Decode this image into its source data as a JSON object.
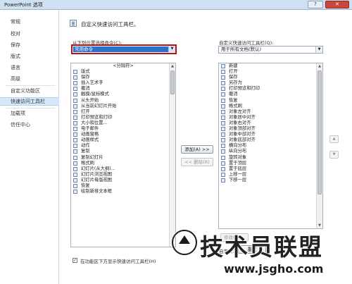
{
  "window": {
    "title": "PowerPoint 选项",
    "help_label": "?",
    "close_label": "✕"
  },
  "sidebar": {
    "items": [
      {
        "label": "常规"
      },
      {
        "label": "校对"
      },
      {
        "label": "保存"
      },
      {
        "label": "版式"
      },
      {
        "label": "语言"
      },
      {
        "label": "高级"
      },
      {
        "label": "自定义功能区"
      },
      {
        "label": "快速访问工具栏"
      },
      {
        "label": "加载项"
      },
      {
        "label": "信任中心"
      }
    ]
  },
  "main": {
    "heading": "自定义快速访问工具栏。",
    "choose_from_label": "从下列位置选择命令(C):",
    "choose_from_value": "常用命令",
    "customize_label": "自定义快速访问工具栏(Q):",
    "customize_value": "用于所有文档(默认)",
    "add_button": "添加(A) >>",
    "remove_button": "<< 删除(R)",
    "modify_button": "修改(M)...",
    "customizations_label": "自定义:",
    "reset_button": "重置",
    "checkbox_label": "在功能区下方显示快速访问工具栏(H)",
    "left_list": [
      {
        "label": "<分隔符>",
        "icon": "",
        "sub": "",
        "center": true
      },
      {
        "label": "版式",
        "icon": "layout-icon",
        "sub": "▸"
      },
      {
        "label": "保存",
        "icon": "save-icon",
        "sub": ""
      },
      {
        "label": "插入艺术字",
        "icon": "wordart-icon",
        "sub": "▸"
      },
      {
        "label": "撤消",
        "icon": "undo-icon",
        "sub": "▸"
      },
      {
        "label": "触摸/鼠标模式",
        "icon": "touch-icon",
        "sub": "▸"
      },
      {
        "label": "从头开始",
        "icon": "slideshow-icon",
        "sub": ""
      },
      {
        "label": "从当前幻灯片开始",
        "icon": "slideshow-current-icon",
        "sub": ""
      },
      {
        "label": "打开",
        "icon": "open-icon",
        "sub": ""
      },
      {
        "label": "打印预览和打印",
        "icon": "print-preview-icon",
        "sub": ""
      },
      {
        "label": "大小和位置...",
        "icon": "size-icon",
        "sub": ""
      },
      {
        "label": "电子邮件",
        "icon": "email-icon",
        "sub": ""
      },
      {
        "label": "动画窗格",
        "icon": "animation-pane-icon",
        "sub": ""
      },
      {
        "label": "动画样式",
        "icon": "animation-style-icon",
        "sub": "▸"
      },
      {
        "label": "动作",
        "icon": "action-icon",
        "sub": ""
      },
      {
        "label": "复制",
        "icon": "copy-icon",
        "sub": ""
      },
      {
        "label": "复制幻灯片",
        "icon": "duplicate-slide-icon",
        "sub": ""
      },
      {
        "label": "格式刷",
        "icon": "format-painter-icon",
        "sub": ""
      },
      {
        "label": "幻灯片(从大纲)...",
        "icon": "slides-outline-icon",
        "sub": ""
      },
      {
        "label": "幻灯片浏览视图",
        "icon": "slide-sorter-icon",
        "sub": ""
      },
      {
        "label": "幻灯片母版视图",
        "icon": "slide-master-icon",
        "sub": ""
      },
      {
        "label": "恢复",
        "icon": "redo-icon",
        "sub": ""
      },
      {
        "label": "绘制新排文本框",
        "icon": "textbox-icon",
        "sub": ""
      }
    ],
    "right_list": [
      {
        "label": "新建",
        "icon": "new-icon",
        "sub": ""
      },
      {
        "label": "打开",
        "icon": "open-icon",
        "sub": ""
      },
      {
        "label": "保存",
        "icon": "save-icon",
        "sub": ""
      },
      {
        "label": "另存为",
        "icon": "save-as-icon",
        "sub": ""
      },
      {
        "label": "打印预览和打印",
        "icon": "print-preview-icon",
        "sub": ""
      },
      {
        "label": "撤消",
        "icon": "undo-icon",
        "sub": "▸"
      },
      {
        "label": "恢复",
        "icon": "redo-icon",
        "sub": ""
      },
      {
        "label": "格式刷",
        "icon": "format-painter-icon",
        "sub": ""
      },
      {
        "label": "对象左对齐",
        "icon": "align-left-icon",
        "sub": ""
      },
      {
        "label": "对象居中对齐",
        "icon": "align-center-icon",
        "sub": ""
      },
      {
        "label": "对象右对齐",
        "icon": "align-right-icon",
        "sub": ""
      },
      {
        "label": "对象顶部对齐",
        "icon": "align-top-icon",
        "sub": ""
      },
      {
        "label": "对象中部对齐",
        "icon": "align-middle-icon",
        "sub": ""
      },
      {
        "label": "对象底部对齐",
        "icon": "align-bottom-icon",
        "sub": ""
      },
      {
        "label": "横向分布",
        "icon": "distribute-h-icon",
        "sub": ""
      },
      {
        "label": "纵向分布",
        "icon": "distribute-v-icon",
        "sub": ""
      },
      {
        "label": "旋转对象",
        "icon": "rotate-icon",
        "sub": "▸"
      },
      {
        "label": "置于顶层",
        "icon": "bring-front-icon",
        "sub": ""
      },
      {
        "label": "置于底层",
        "icon": "send-back-icon",
        "sub": ""
      },
      {
        "label": "上移一层",
        "icon": "bring-forward-icon",
        "sub": ""
      },
      {
        "label": "下移一层",
        "icon": "send-backward-icon",
        "sub": ""
      }
    ]
  },
  "watermark": {
    "title": "技术员联盟",
    "url": "www.jsgho.com"
  },
  "colors": {
    "highlight_border": "#b5121b",
    "selection": "#2a71c8",
    "sidebar_active": "#d6e7f8"
  }
}
